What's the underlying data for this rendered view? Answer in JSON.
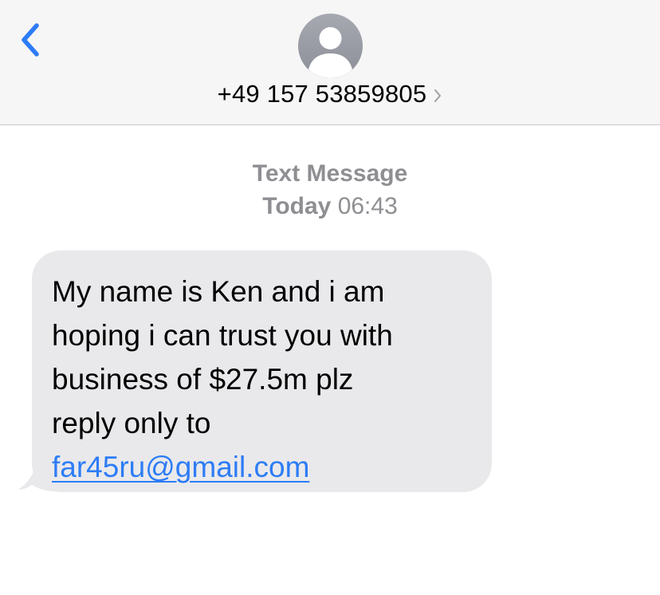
{
  "header": {
    "back_icon": "chevron-left-icon",
    "avatar_icon": "person-silhouette-icon",
    "contact_number": "+49 157 53859805",
    "contact_chevron_icon": "chevron-right-icon"
  },
  "thread": {
    "message_type": "Text Message",
    "timestamp_day": "Today",
    "timestamp_time": "06:43"
  },
  "message": {
    "direction": "incoming",
    "body": "My name is Ken and i am\nhoping i can trust you with\nbusiness of $27.5m plz\nreply only to",
    "link": "far45ru@gmail.com"
  },
  "colors": {
    "header_bg": "#f6f6f6",
    "accent": "#2d7cf6",
    "bubble_bg": "#e9e9eb",
    "meta_text": "#8e8e93",
    "avatar": "#9a9ca4"
  }
}
